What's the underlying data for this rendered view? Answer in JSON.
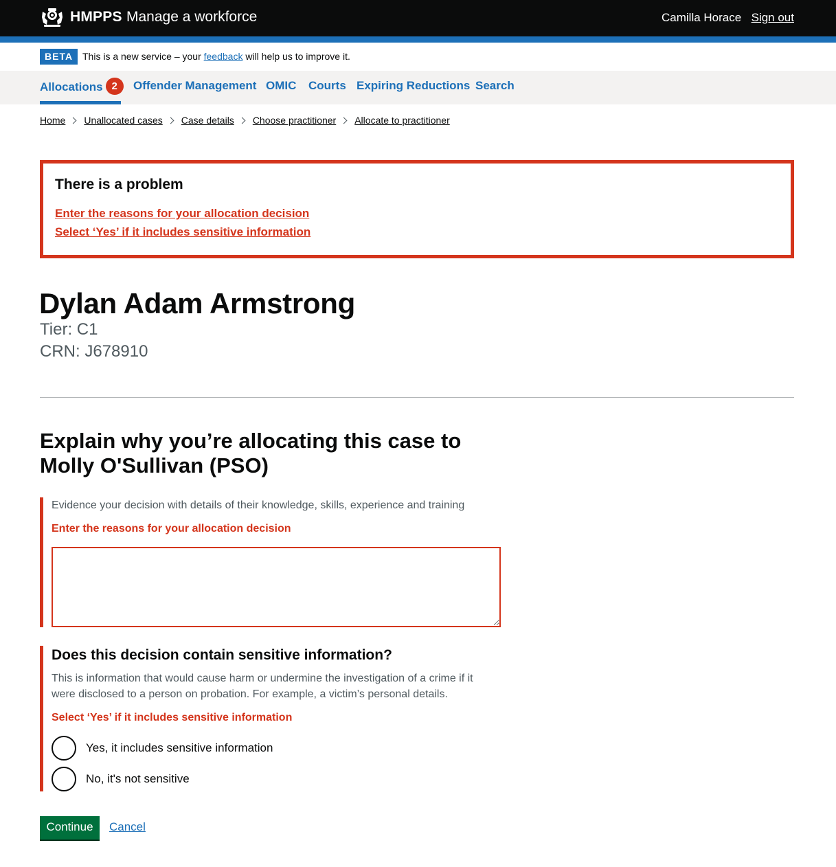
{
  "header": {
    "logo_text": "HMPPS",
    "service_name": "Manage a workforce",
    "user_name": "Camilla Horace",
    "sign_out": "Sign out"
  },
  "phase_banner": {
    "tag": "BETA",
    "text_before": "This is a new service – your ",
    "link": "feedback",
    "text_after": " will help us to improve it."
  },
  "nav": {
    "items": [
      {
        "label": "Allocations",
        "badge": "2",
        "active": true
      },
      {
        "label": "Offender Management"
      },
      {
        "label": "OMIC"
      },
      {
        "label": "Courts"
      },
      {
        "label": "Expiring Reductions"
      },
      {
        "label": "Search"
      }
    ]
  },
  "breadcrumbs": [
    "Home",
    "Unallocated cases",
    "Case details",
    "Choose practitioner",
    "Allocate to practitioner"
  ],
  "error_summary": {
    "title": "There is a problem",
    "errors": [
      "Enter the reasons for your allocation decision",
      "Select ‘Yes’ if it includes sensitive information"
    ]
  },
  "person": {
    "name": "Dylan Adam Armstrong",
    "tier": "Tier: C1",
    "crn": "CRN: J678910"
  },
  "form": {
    "heading": "Explain why you’re allocating this case to Molly O'Sullivan (PSO)",
    "reasons_hint": "Evidence your decision with details of their knowledge, skills, experience and training",
    "reasons_error": "Enter the reasons for your allocation decision",
    "reasons_value": "",
    "sensitive_legend": "Does this decision contain sensitive information?",
    "sensitive_hint": "This is information that would cause harm or undermine the investigation of a crime if it were disclosed to a person on probation. For example, a victim’s personal details.",
    "sensitive_error": "Select ‘Yes’ if it includes sensitive information",
    "options": [
      "Yes, it includes sensitive information",
      "No, it's not sensitive"
    ],
    "continue_label": "Continue",
    "cancel_label": "Cancel"
  },
  "colors": {
    "header_bg": "#0b0c0c",
    "brand_blue": "#1d70b8",
    "error_red": "#d4351c",
    "button_green": "#00703c",
    "nav_bg": "#f3f2f1"
  }
}
